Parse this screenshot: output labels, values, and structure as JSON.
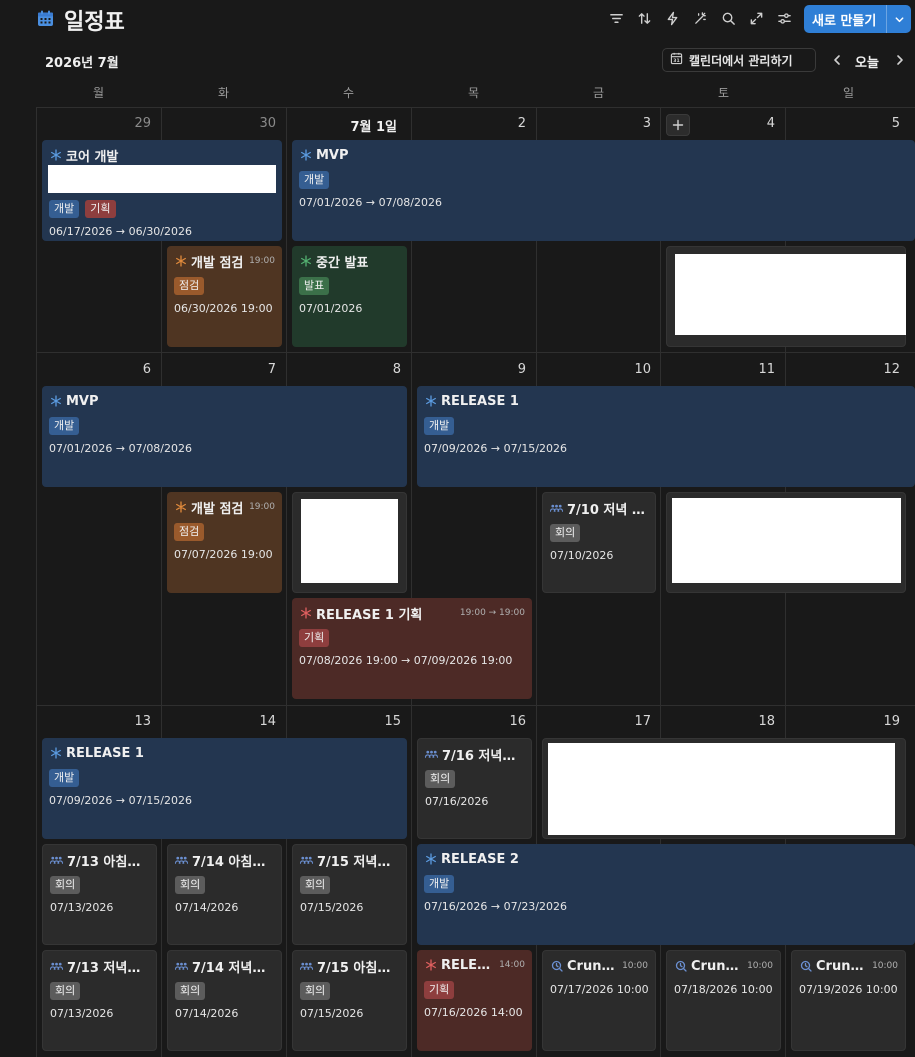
{
  "header": {
    "title": "일정표",
    "new_button_label": "새로 만들기",
    "month_label": "2026년 7월",
    "manage_label": "캘린더에서 관리하기",
    "today_label": "오늘",
    "toolbar_icons": [
      "filter-icon",
      "sort-icon",
      "lightning-icon",
      "sparkle-icon",
      "search-icon",
      "expand-icon",
      "settings-sliders-icon"
    ]
  },
  "weekdays": [
    "월",
    "화",
    "수",
    "목",
    "금",
    "토",
    "일"
  ],
  "weeks": [
    {
      "days": [
        "29",
        "30",
        "7월 1일",
        "2",
        "3",
        "4",
        "5"
      ]
    },
    {
      "days": [
        "6",
        "7",
        "8",
        "9",
        "10",
        "11",
        "12"
      ]
    },
    {
      "days": [
        "13",
        "14",
        "15",
        "16",
        "17",
        "18",
        "19"
      ]
    }
  ],
  "tags": {
    "dev": "개발",
    "plan": "기획",
    "check": "점검",
    "pres": "발표",
    "meet": "회의"
  },
  "events": {
    "e1": {
      "title": "코어 개발",
      "date": "06/17/2026 → 06/30/2026"
    },
    "e2": {
      "title": "MVP",
      "date": "07/01/2026 → 07/08/2026"
    },
    "e3": {
      "title": "개발 점검",
      "time": "19:00",
      "date": "06/30/2026 19:00"
    },
    "e4": {
      "title": "중간 발표",
      "date": "07/01/2026"
    },
    "e5": {
      "title": "MVP",
      "date": "07/01/2026 → 07/08/2026"
    },
    "e6": {
      "title": "RELEASE 1",
      "date": "07/09/2026 → 07/15/2026"
    },
    "e7": {
      "title": "개발 점검",
      "time": "19:00",
      "date": "07/07/2026 19:00"
    },
    "e8": {
      "title": "7/10 저녁 회...",
      "date": "07/10/2026"
    },
    "e9": {
      "title": "RELEASE 1 기획",
      "time": "19:00 → 19:00",
      "date": "07/08/2026 19:00 → 07/09/2026 19:00"
    },
    "e10": {
      "title": "RELEASE 1",
      "date": "07/09/2026 → 07/15/2026"
    },
    "e11": {
      "title": "7/16 저녁회의",
      "date": "07/16/2026"
    },
    "e12": {
      "title": "7/13 아침회의",
      "date": "07/13/2026"
    },
    "e13": {
      "title": "7/14 아침회의",
      "date": "07/14/2026"
    },
    "e14": {
      "title": "7/15 저녁회...",
      "date": "07/15/2026"
    },
    "e15": {
      "title": "RELEASE 2",
      "date": "07/16/2026 → 07/23/2026"
    },
    "e16": {
      "title": "7/13 저녁회의",
      "date": "07/13/2026"
    },
    "e17": {
      "title": "7/14 저녁회의",
      "date": "07/14/2026"
    },
    "e18": {
      "title": "7/15 아침회...",
      "date": "07/15/2026"
    },
    "e19": {
      "title": "RELEA...",
      "time": "14:00",
      "date": "07/16/2026 14:00 →"
    },
    "e20": {
      "title": "Crunc...",
      "time": "10:00",
      "date": "07/17/2026 10:00 →"
    },
    "e21": {
      "title": "Crunc...",
      "time": "10:00",
      "date": "07/18/2026 10:00 →"
    },
    "e22": {
      "title": "Crunc...",
      "time": "10:00",
      "date": "07/19/2026 10:00 →"
    }
  },
  "colors": {
    "accent": "#2f7fd6",
    "asterisk_blue": "#5b9be0",
    "asterisk_orange": "#e08a3c",
    "asterisk_green": "#53b070",
    "asterisk_red": "#e06060",
    "meeting_icon": "#6b8fd0"
  }
}
